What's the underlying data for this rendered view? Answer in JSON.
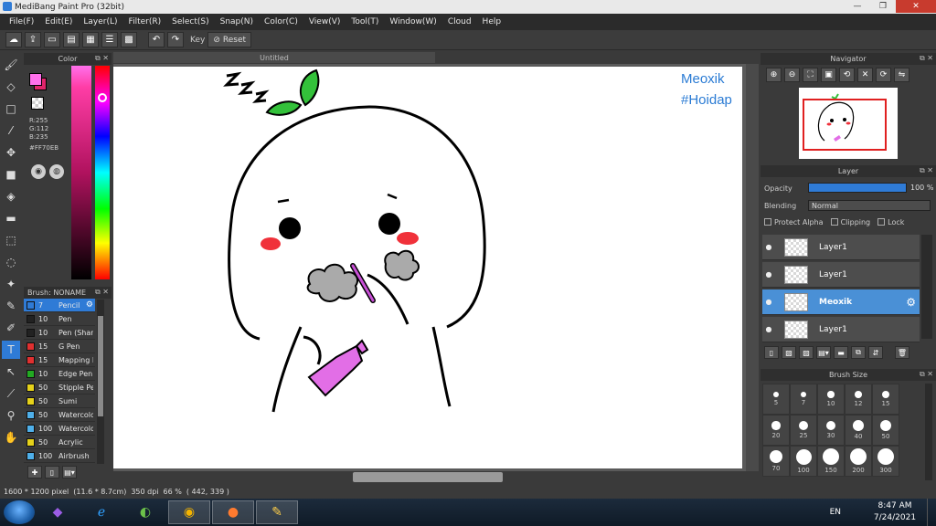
{
  "window": {
    "title": "MediBang Paint Pro (32bit)",
    "minimize": "—",
    "maximize": "❐",
    "close": "✕"
  },
  "menu": [
    "File(F)",
    "Edit(E)",
    "Layer(L)",
    "Filter(R)",
    "Select(S)",
    "Snap(N)",
    "Color(C)",
    "View(V)",
    "Tool(T)",
    "Window(W)",
    "Cloud",
    "Help"
  ],
  "toolbar": {
    "key_label": "Key",
    "reset_label": "Reset"
  },
  "color_panel": {
    "title": "Color",
    "r": "R:255",
    "g": "G:112",
    "b": "B:235",
    "hex": "#FF70EB",
    "fg_color": "#ff70eb"
  },
  "brush_panel": {
    "title": "Brush: NONAME",
    "items": [
      {
        "size": "7",
        "name": "Pencil",
        "color": "#2f7bd6"
      },
      {
        "size": "10",
        "name": "Pen",
        "color": "#222222"
      },
      {
        "size": "10",
        "name": "Pen (Sharp)",
        "color": "#222222"
      },
      {
        "size": "15",
        "name": "G Pen",
        "color": "#e03030"
      },
      {
        "size": "15",
        "name": "Mapping Pen",
        "color": "#e03030"
      },
      {
        "size": "10",
        "name": "Edge Pen",
        "color": "#22aa22"
      },
      {
        "size": "50",
        "name": "Stipple Pen",
        "color": "#e6d21a"
      },
      {
        "size": "50",
        "name": "Sumi",
        "color": "#e6d21a"
      },
      {
        "size": "50",
        "name": "Watercolor",
        "color": "#4fb0ea"
      },
      {
        "size": "100",
        "name": "Watercolor",
        "color": "#4fb0ea"
      },
      {
        "size": "50",
        "name": "Acrylic",
        "color": "#e6d21a"
      },
      {
        "size": "100",
        "name": "Airbrush",
        "color": "#4fb0ea"
      }
    ]
  },
  "document": {
    "tab": "Untitled",
    "text_line1": "Meoxik",
    "text_line2": "#Hoidap"
  },
  "status": {
    "size": "1600 * 1200 pixel",
    "physical": "(11.6 * 8.7cm)",
    "dpi": "350 dpi",
    "zoom": "66 %",
    "coords": "( 442, 339 )"
  },
  "navigator": {
    "title": "Navigator"
  },
  "layer_panel": {
    "title": "Layer",
    "opacity_label": "Opacity",
    "opacity_value": "100 %",
    "opacity": 1.0,
    "blending_label": "Blending",
    "blending_value": "Normal",
    "protect_alpha": "Protect Alpha",
    "clipping": "Clipping",
    "lock": "Lock",
    "layers": [
      {
        "name": "Layer1",
        "active": false
      },
      {
        "name": "Layer1",
        "active": false
      },
      {
        "name": "Meoxik",
        "active": true
      },
      {
        "name": "Layer1",
        "active": false
      }
    ]
  },
  "brush_size": {
    "title": "Brush Size",
    "sizes": [
      "5",
      "7",
      "10",
      "12",
      "15",
      "20",
      "25",
      "30",
      "40",
      "50",
      "70",
      "100",
      "150",
      "200",
      "300"
    ]
  },
  "taskbar": {
    "lang": "EN",
    "time": "8:47 AM",
    "date": "7/24/2021"
  }
}
